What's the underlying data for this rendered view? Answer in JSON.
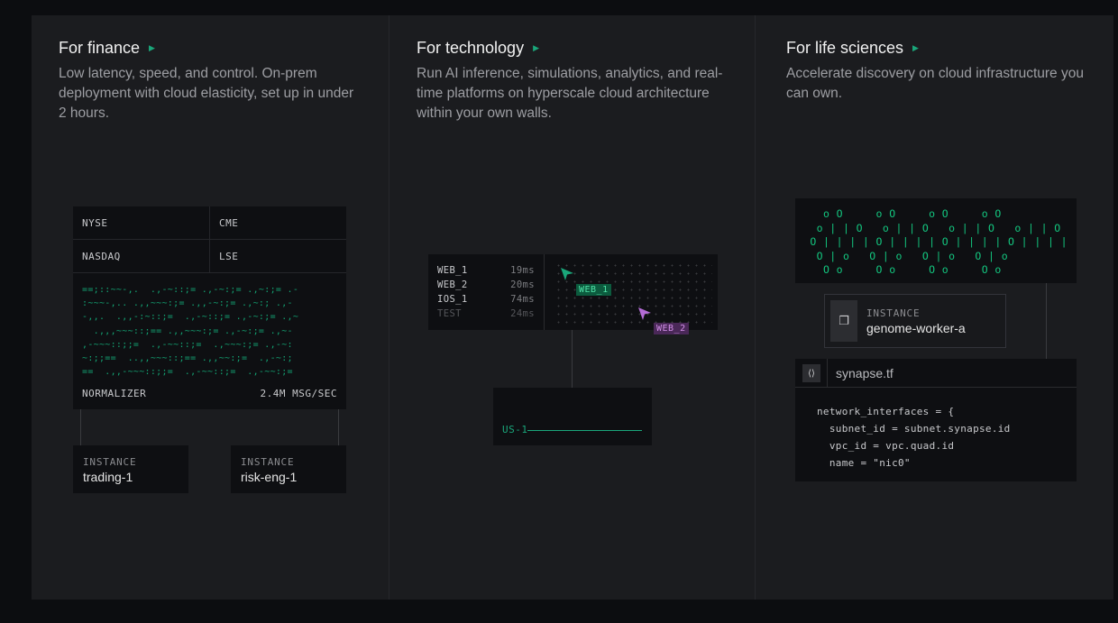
{
  "columns": {
    "finance": {
      "title": "For finance",
      "description": "Low latency, speed, and control. On-prem deployment with cloud elasticity, set up in under 2 hours.",
      "exchanges": [
        "NYSE",
        "CME",
        "NASDAQ",
        "LSE"
      ],
      "stream": "==;::~~-,.  .,-~::;= .,-~:;= .,~:;= .-\n:~~~-,.. .,,~~~:;= .,,-~:;= .,~:; .,-\n-,,.  .,,-:~::;=  .,-~::;= .,-~:;= .,~\n  .,,,~~~::;== .,,~~~:;= .,-~:;= .,~-\n,-~~~::;;=  .,-~~::;=  .,~~~:;= .,-~:\n~:;;==  ..,,~~~::;== .,,~~:;=  .,-~:;\n==  .,,-~~~::;;=  .,-~~::;=  .,-~~:;=",
      "normalizer_label": "NORMALIZER",
      "normalizer_rate": "2.4M MSG/SEC",
      "instances": [
        {
          "label": "INSTANCE",
          "name": "trading-1"
        },
        {
          "label": "INSTANCE",
          "name": "risk-eng-1"
        }
      ]
    },
    "technology": {
      "title": "For technology",
      "description": "Run AI inference, simulations, analytics, and real-time platforms on hyperscale cloud architecture within your own walls.",
      "latency": [
        {
          "name": "WEB_1",
          "ms": "19ms"
        },
        {
          "name": "WEB_2",
          "ms": "20ms"
        },
        {
          "name": "IOS_1",
          "ms": "74ms"
        },
        {
          "name": "TEST",
          "ms": "24ms"
        }
      ],
      "tags": [
        "WEB_1",
        "WEB_2"
      ],
      "region": "US-1"
    },
    "life_sciences": {
      "title": "For life sciences",
      "description": "Accelerate discovery on cloud infrastructure you can own.",
      "dna": "   o O     o O     o O     o O\n  o | | O   o | | O   o | | O   o | | O\n O | | | | O | | | | O | | | | O | | | |\n  O | o   O | o   O | o   O | o\n   O o     O o     O o     O o",
      "instance": {
        "label": "INSTANCE",
        "name": "genome-worker-a"
      },
      "file_name": "synapse.tf",
      "code": "network_interfaces = {\n  subnet_id = subnet.synapse.id\n  vpc_id = vpc.quad.id\n  name = \"nic0\""
    }
  },
  "colors": {
    "accent": "#1aa67a",
    "purple": "#b46cd6"
  },
  "icons": [
    "play-arrow-icon",
    "cursor-arrow-icon",
    "copy-icon",
    "file-code-icon"
  ]
}
